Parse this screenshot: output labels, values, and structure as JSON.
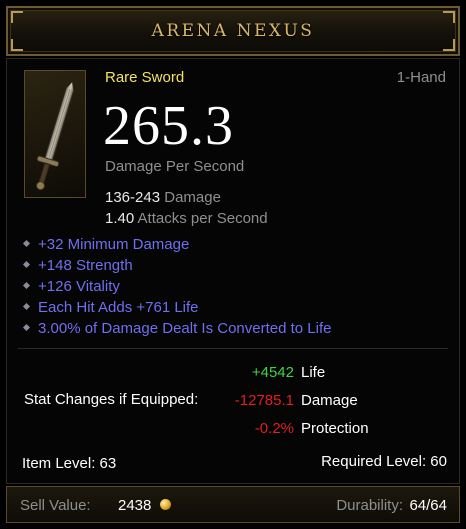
{
  "header": {
    "title": "ARENA NEXUS"
  },
  "item": {
    "rarity": "Rare Sword",
    "slot": "1-Hand",
    "dps": "265.3",
    "dps_label": "Damage Per Second",
    "damage_value": "136-243",
    "damage_label": "Damage",
    "aps_value": "1.40",
    "aps_label": "Attacks per Second",
    "icon": "sword-icon"
  },
  "affixes": [
    "+32 Minimum Damage",
    "+148 Strength",
    "+126 Vitality",
    "Each Hit Adds +761 Life",
    "3.00% of Damage Dealt Is Converted to Life"
  ],
  "stat_changes": {
    "title": "Stat Changes if Equipped:",
    "rows": [
      {
        "value": "+4542",
        "label": "Life",
        "color": "#3fd43f"
      },
      {
        "value": "-12785.1",
        "label": "Damage",
        "color": "#e21e1e"
      },
      {
        "value": "-0.2%",
        "label": "Protection",
        "color": "#e21e1e"
      }
    ]
  },
  "levels": {
    "item_level": "Item Level: 63",
    "required_level": "Required Level: 60"
  },
  "footer": {
    "sell_label": "Sell Value:",
    "sell_value": "2438",
    "currency_icon": "gold-coin-icon",
    "durability_label": "Durability:",
    "durability_value": "64/64"
  },
  "colors": {
    "rare": "#f2e35f",
    "magic_affix": "#6f6ff0",
    "positive": "#3fd43f",
    "negative": "#e21e1e",
    "gold_trim": "#d8b867"
  }
}
